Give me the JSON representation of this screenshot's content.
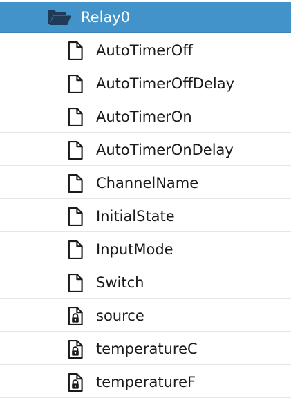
{
  "tree": {
    "folder": {
      "label": "Relay0",
      "icon": "folder-open-icon",
      "selected_color": "#4293c9"
    },
    "items": [
      {
        "label": "AutoTimerOff",
        "icon": "file-icon"
      },
      {
        "label": "AutoTimerOffDelay",
        "icon": "file-icon"
      },
      {
        "label": "AutoTimerOn",
        "icon": "file-icon"
      },
      {
        "label": "AutoTimerOnDelay",
        "icon": "file-icon"
      },
      {
        "label": "ChannelName",
        "icon": "file-icon"
      },
      {
        "label": "InitialState",
        "icon": "file-icon"
      },
      {
        "label": "InputMode",
        "icon": "file-icon"
      },
      {
        "label": "Switch",
        "icon": "file-icon"
      },
      {
        "label": "source",
        "icon": "locked-file-icon"
      },
      {
        "label": "temperatureC",
        "icon": "locked-file-icon"
      },
      {
        "label": "temperatureF",
        "icon": "locked-file-icon"
      }
    ]
  }
}
